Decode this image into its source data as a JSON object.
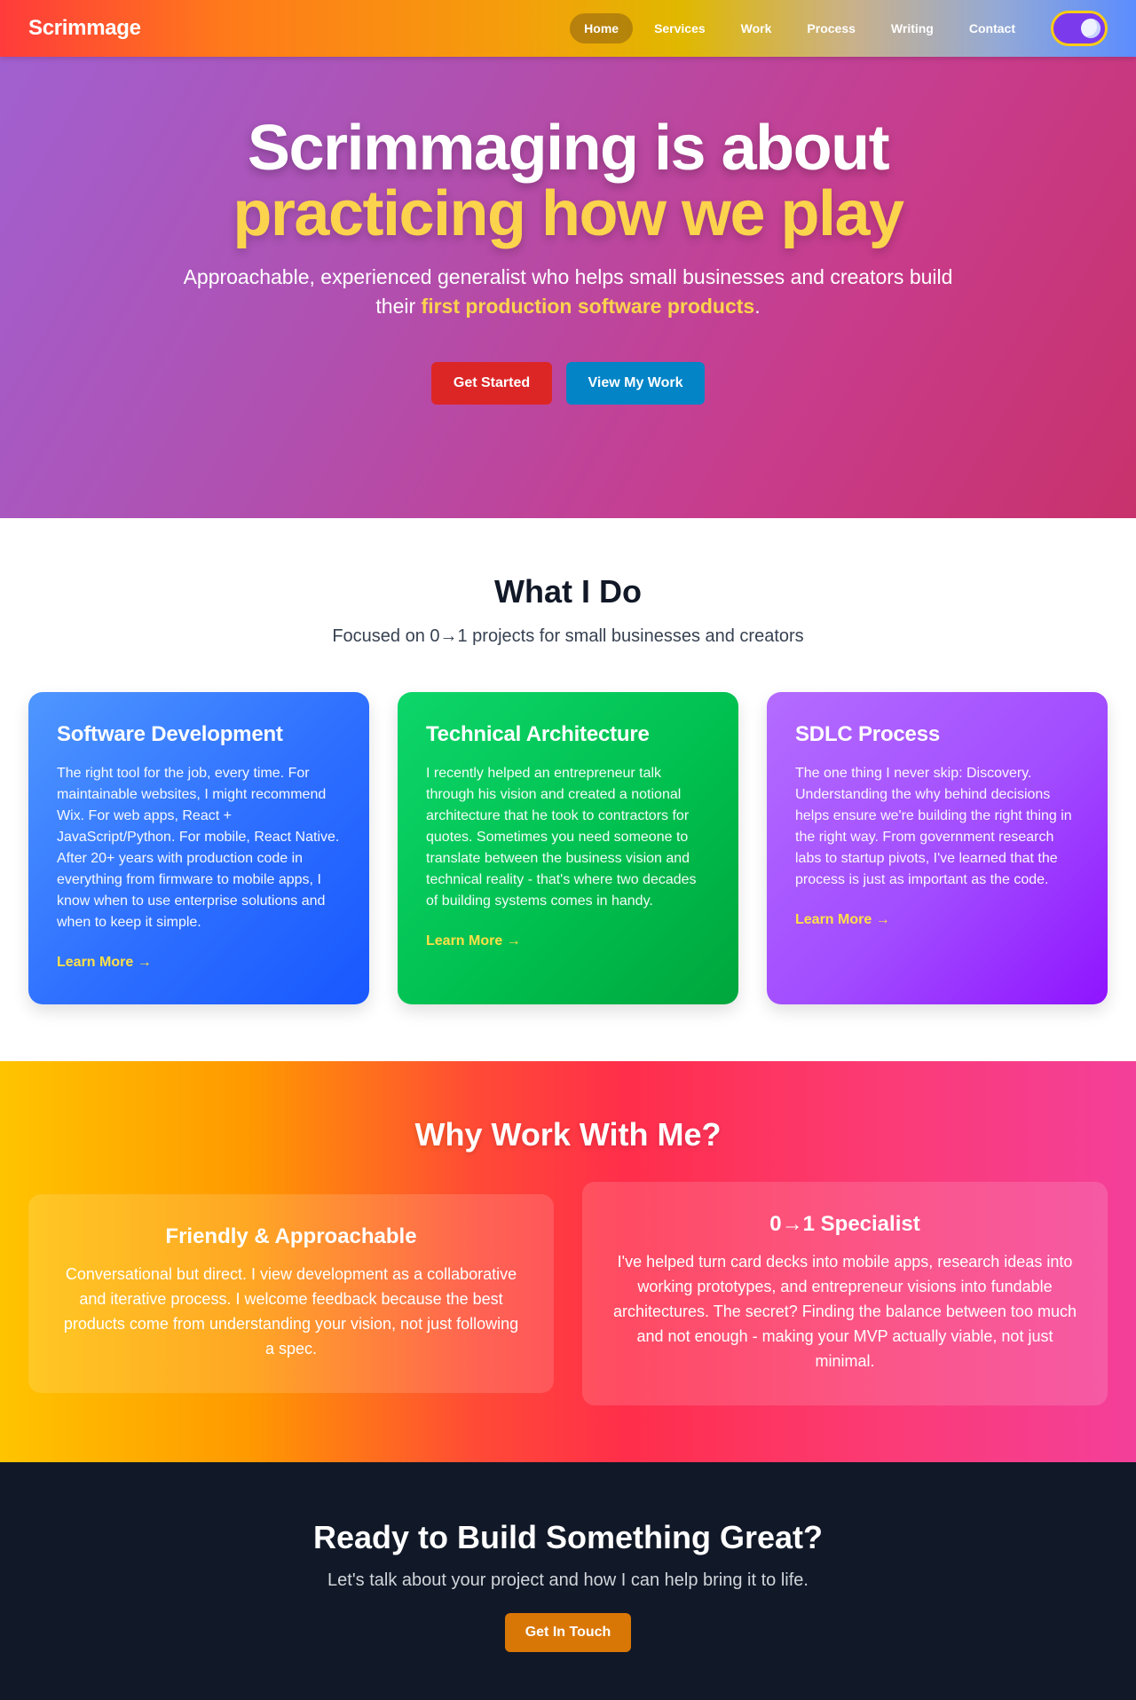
{
  "nav": {
    "brand": "Scrimmage",
    "items": [
      {
        "label": "Home",
        "active": true
      },
      {
        "label": "Services",
        "active": false
      },
      {
        "label": "Work",
        "active": false
      },
      {
        "label": "Process",
        "active": false
      },
      {
        "label": "Writing",
        "active": false
      },
      {
        "label": "Contact",
        "active": false
      }
    ],
    "theme_toggle_icon": "moon-icon"
  },
  "hero": {
    "line1": "Scrimmaging is about",
    "line2": "practicing how we play",
    "subtitle_prefix": "Approachable, experienced generalist who helps small businesses and creators build their ",
    "subtitle_highlight": "first production software products",
    "subtitle_suffix": ".",
    "primary_button": "Get Started",
    "secondary_button": "View My Work"
  },
  "services": {
    "title": "What I Do",
    "subtitle": "Focused on 0→1 projects for small businesses and creators",
    "cards": [
      {
        "title": "Software Development",
        "text": "The right tool for the job, every time. For maintainable websites, I might recommend Wix. For web apps, React + JavaScript/Python. For mobile, React Native. After 20+ years with production code in everything from firmware to mobile apps, I know when to use enterprise solutions and when to keep it simple.",
        "link": "Learn More →"
      },
      {
        "title": "Technical Architecture",
        "text": "I recently helped an entrepreneur talk through his vision and created a notional architecture that he took to contractors for quotes. Sometimes you need someone to translate between the business vision and technical reality - that's where two decades of building systems comes in handy.",
        "link": "Learn More →"
      },
      {
        "title": "SDLC Process",
        "text": "The one thing I never skip: Discovery. Understanding the why behind decisions helps ensure we're building the right thing in the right way. From government research labs to startup pivots, I've learned that the process is just as important as the code.",
        "link": "Learn More →"
      }
    ]
  },
  "why": {
    "title": "Why Work With Me?",
    "boxes": [
      {
        "title": "Friendly & Approachable",
        "text": "Conversational but direct. I view development as a collaborative and iterative process. I welcome feedback because the best products come from understanding your vision, not just following a spec."
      },
      {
        "title": "0→1 Specialist",
        "text": "I've helped turn card decks into mobile apps, research ideas into working prototypes, and entrepreneur visions into fundable architectures. The secret? Finding the balance between too much and not enough - making your MVP actually viable, not just minimal."
      }
    ]
  },
  "cta": {
    "title": "Ready to Build Something Great?",
    "subtitle": "Let's talk about your project and how I can help bring it to life.",
    "button": "Get In Touch"
  }
}
